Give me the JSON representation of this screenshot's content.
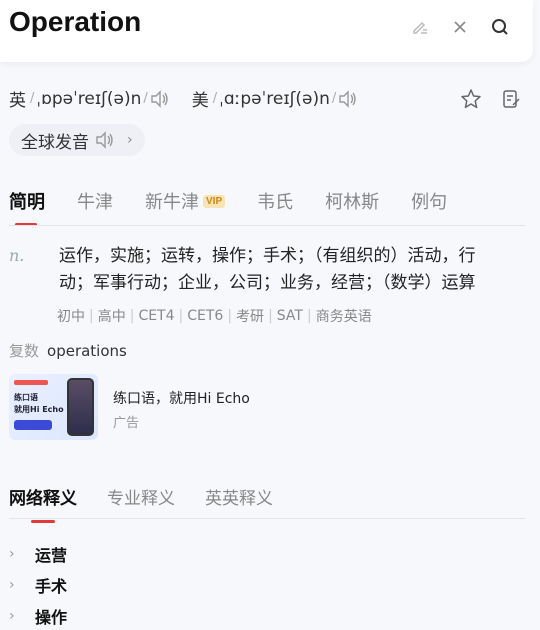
{
  "search": {
    "query": "Operation"
  },
  "pronunciation": {
    "uk": {
      "label": "英",
      "ipa": "ˌɒpəˈreɪʃ(ə)n"
    },
    "us": {
      "label": "美",
      "ipa": "ˌɑːpəˈreɪʃ(ə)n"
    },
    "global_label": "全球发音"
  },
  "tabs": [
    {
      "label": "简明",
      "active": true
    },
    {
      "label": "牛津"
    },
    {
      "label": "新牛津",
      "badge": "VIP"
    },
    {
      "label": "韦氏"
    },
    {
      "label": "柯林斯"
    },
    {
      "label": "例句"
    }
  ],
  "definition": {
    "pos": "n.",
    "text": "运作，实施；运转，操作；手术；（有组织的）活动，行动；军事行动；企业，公司；业务，经营；（数学）运算",
    "levels": [
      "初中",
      "高中",
      "CET4",
      "CET6",
      "考研",
      "SAT",
      "商务英语"
    ]
  },
  "plural": {
    "label": "复数",
    "value": "operations"
  },
  "ad": {
    "title": "练口语，就用Hi Echo",
    "tag": "广告",
    "thumb_line1": "练口语",
    "thumb_line2": "就用Hi Echo"
  },
  "tabs2": [
    {
      "label": "网络释义",
      "active": true
    },
    {
      "label": "专业释义"
    },
    {
      "label": "英英释义"
    }
  ],
  "web_defs": [
    "运营",
    "手术",
    "操作"
  ],
  "colors": {
    "accent": "#e03a3a",
    "vip_bg": "#f8e3b5"
  }
}
